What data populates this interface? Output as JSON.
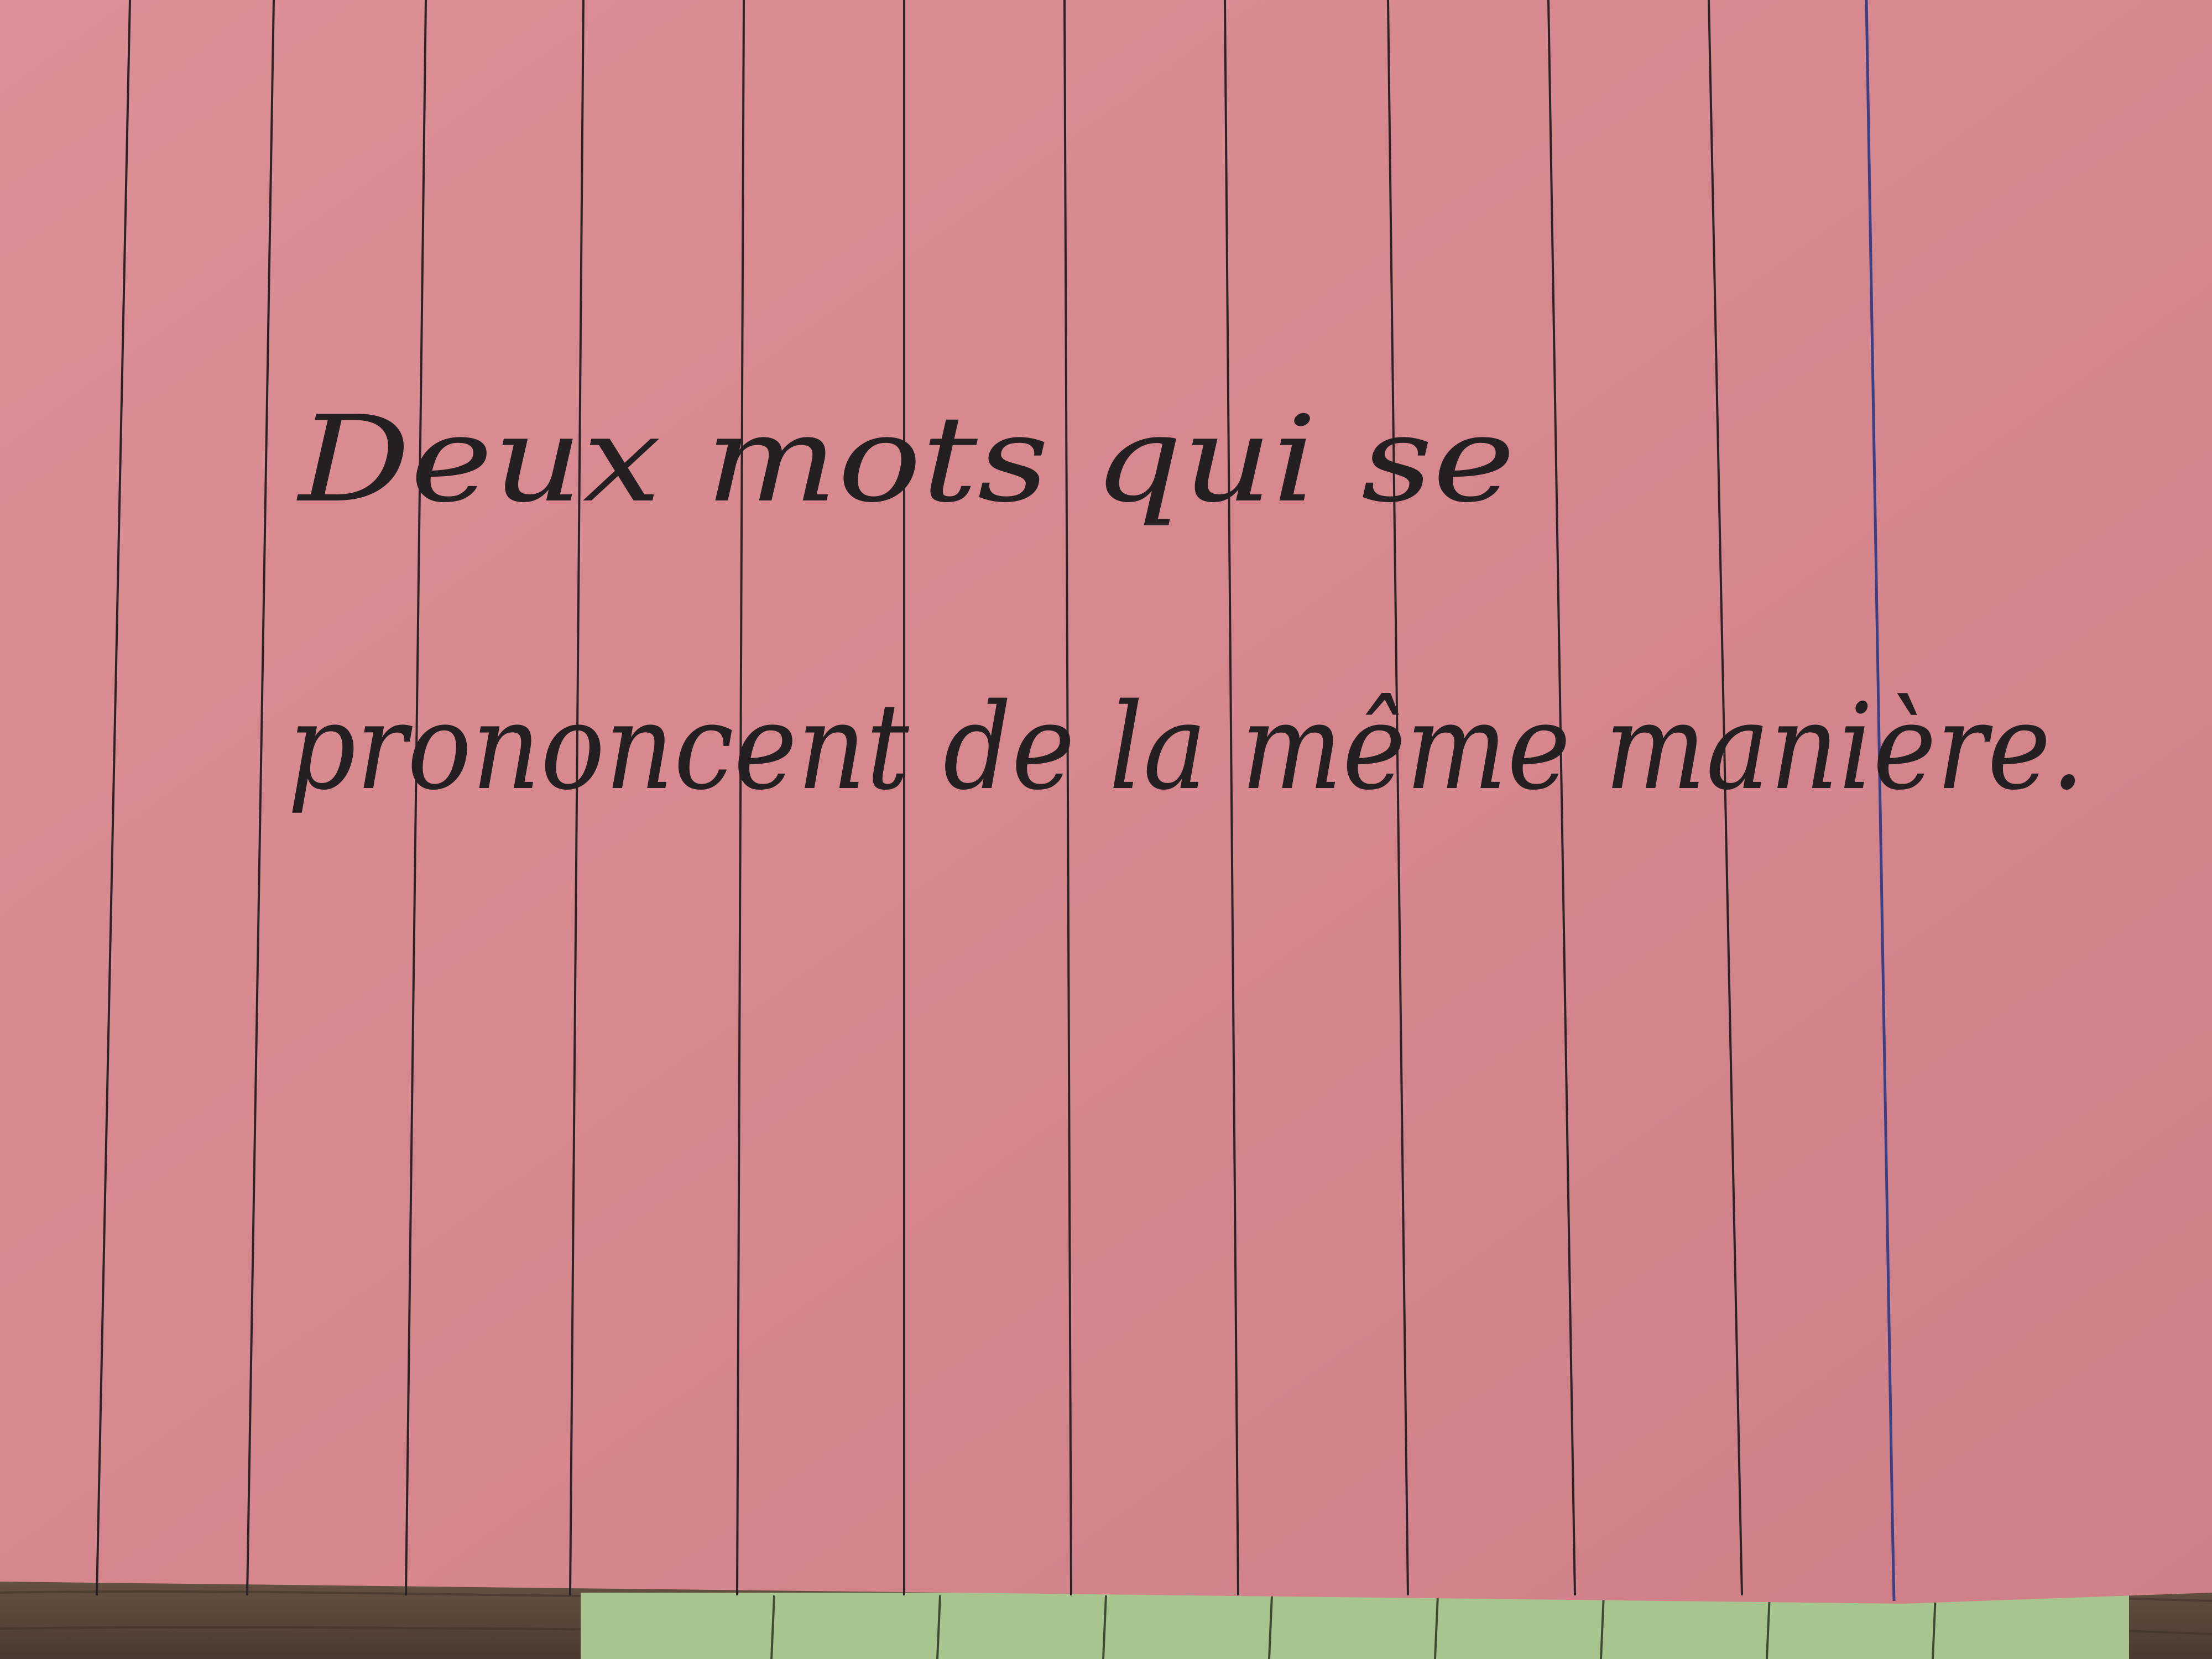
{
  "card": {
    "color": "#d98a91",
    "line_color": "#2b2325",
    "margin_line_color": "#3a3f86",
    "ink_color": "#242022",
    "text_lines": [
      "Deux mots qui se",
      "prononcent de la même manière."
    ]
  },
  "under_card": {
    "color": "#a8c58f"
  },
  "table": {
    "color": "#5c4a3c"
  }
}
